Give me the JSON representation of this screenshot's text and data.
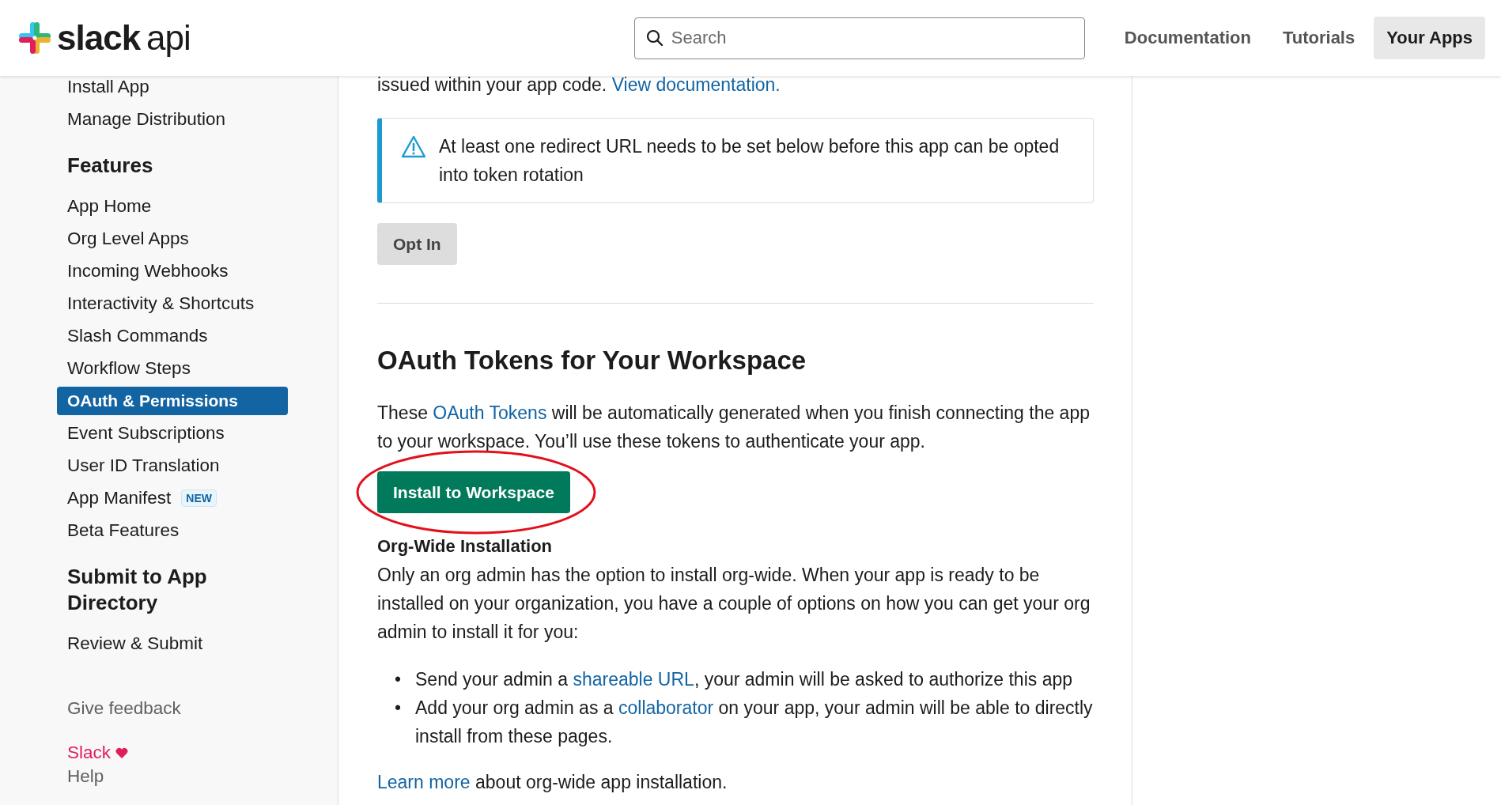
{
  "header": {
    "logo": {
      "brand": "slack",
      "suffix": "api"
    },
    "search": {
      "placeholder": "Search"
    },
    "nav": [
      {
        "label": "Documentation",
        "selected": false
      },
      {
        "label": "Tutorials",
        "selected": false
      },
      {
        "label": "Your Apps",
        "selected": true
      }
    ]
  },
  "sidebar": {
    "sections": [
      {
        "items": [
          {
            "label": "Install App",
            "selected": false
          },
          {
            "label": "Manage Distribution",
            "selected": false
          }
        ]
      },
      {
        "heading": "Features",
        "items": [
          {
            "label": "App Home",
            "selected": false
          },
          {
            "label": "Org Level Apps",
            "selected": false
          },
          {
            "label": "Incoming Webhooks",
            "selected": false
          },
          {
            "label": "Interactivity & Shortcuts",
            "selected": false
          },
          {
            "label": "Slash Commands",
            "selected": false
          },
          {
            "label": "Workflow Steps",
            "selected": false
          },
          {
            "label": "OAuth & Permissions",
            "selected": true
          },
          {
            "label": "Event Subscriptions",
            "selected": false
          },
          {
            "label": "User ID Translation",
            "selected": false
          },
          {
            "label": "App Manifest",
            "selected": false,
            "badge": "NEW"
          },
          {
            "label": "Beta Features",
            "selected": false
          }
        ]
      },
      {
        "heading": "Submit to App Directory",
        "items": [
          {
            "label": "Review & Submit",
            "selected": false
          }
        ]
      }
    ],
    "footer": {
      "feedback": "Give feedback",
      "brand": "Slack",
      "help": "Help"
    }
  },
  "content": {
    "intro": [
      {
        "text": "issued within your app code. "
      },
      {
        "text": "View documentation.",
        "link": true
      }
    ],
    "alert": {
      "text": "At least one redirect URL needs to be set below before this app can be opted into token rotation"
    },
    "opt_in_button": {
      "label": "Opt In"
    },
    "section": {
      "title": "OAuth Tokens for Your Workspace",
      "paragraph": [
        {
          "text": "These "
        },
        {
          "text": "OAuth Tokens",
          "link": true
        },
        {
          "text": " will be automatically generated when you finish connecting the app to your workspace. You’ll use these tokens to authenticate your app."
        }
      ],
      "install_button": {
        "label": "Install to Workspace",
        "circled": true
      },
      "org_wide": {
        "title": "Org-Wide Installation",
        "paragraph": [
          {
            "text": "Only an org admin has the option to install org-wide. When your app is ready to be installed on your organization, you have a couple of options on how you can get your org admin to install it for you:"
          }
        ],
        "bullet_marker": "•",
        "bullets": [
          [
            {
              "text": "Send your admin a "
            },
            {
              "text": "shareable URL",
              "link": true
            },
            {
              "text": ", your admin will be asked to authorize this app"
            }
          ],
          [
            {
              "text": "Add your org admin as a "
            },
            {
              "text": "collaborator",
              "link": true
            },
            {
              "text": " on your app, your admin will be able to directly install from these pages."
            }
          ]
        ],
        "footer": [
          {
            "text": "Learn more",
            "link": true
          },
          {
            "text": " about org-wide app installation."
          }
        ]
      }
    }
  }
}
